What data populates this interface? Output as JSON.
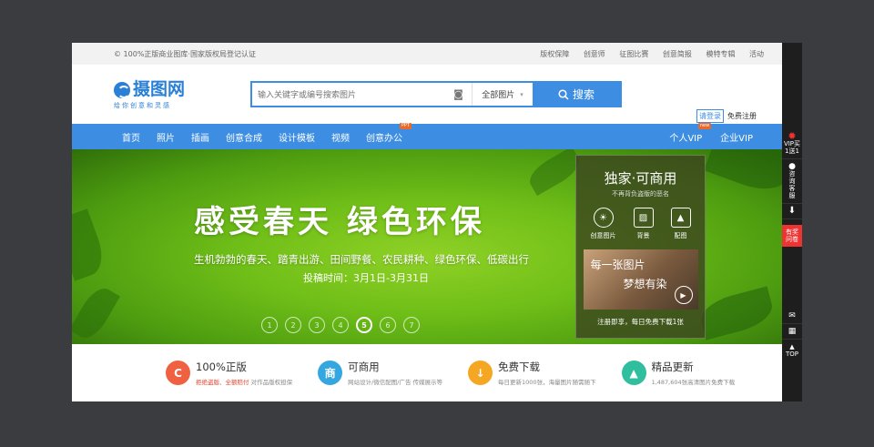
{
  "topbar": {
    "notice": "© 100%正版商业图库·国家版权局登记认证",
    "links": [
      "版权保障",
      "创意师",
      "征图比赛",
      "创意简报",
      "模特专辑",
      "活动"
    ]
  },
  "logo": {
    "name": "摄图网",
    "tagline": "给你创意和灵感"
  },
  "search": {
    "placeholder": "输入关键字或编号搜索图片",
    "category": "全部图片",
    "button": "搜索"
  },
  "auth": {
    "login": "请登录",
    "register": "免费注册"
  },
  "nav": {
    "items": [
      {
        "label": "首页"
      },
      {
        "label": "照片"
      },
      {
        "label": "插画"
      },
      {
        "label": "创意合成"
      },
      {
        "label": "设计模板"
      },
      {
        "label": "视频"
      },
      {
        "label": "创意办公",
        "badge": "PPT"
      }
    ],
    "right": [
      {
        "label": "个人VIP",
        "badge": "new"
      },
      {
        "label": "企业VIP"
      }
    ]
  },
  "banner": {
    "title": "感受春天 绿色环保",
    "subtitle": "生机勃勃的春天、踏青出游、田间野餐、农民耕种、绿色环保、低碳出行",
    "date": "投稿时间：3月1日-3月31日",
    "dots": [
      "1",
      "2",
      "3",
      "4",
      "5",
      "6",
      "7"
    ],
    "active_dot": "5"
  },
  "side_panel": {
    "title": "独家·可商用",
    "subtitle": "不再背负盗版的恶名",
    "features": [
      {
        "icon": "lightbulb-icon",
        "label": "创意图片"
      },
      {
        "icon": "texture-icon",
        "label": "背景"
      },
      {
        "icon": "image-icon",
        "label": "配图"
      }
    ],
    "promo_line1": "每一张图片",
    "promo_line2": "梦想有染",
    "footer": "注册即享，每日免费下载1张"
  },
  "features": [
    {
      "icon": "C",
      "color": "#ef6140",
      "title": "100%正版",
      "desc_red": "拒绝盗版、全额赔付",
      "desc": "对作品版权担保"
    },
    {
      "icon": "商",
      "color": "#35a7e0",
      "title": "可商用",
      "desc_red": "",
      "desc": "网站设计/微信配图/广告 传媒展示等"
    },
    {
      "icon": "↓",
      "color": "#f5a623",
      "title": "免费下载",
      "desc_red": "",
      "desc": "每日更新1000张，海量图片随需随下"
    },
    {
      "icon": "▲",
      "color": "#2fbf9e",
      "title": "精品更新",
      "desc_red": "",
      "desc": "1,487,604张高清图片免费下载"
    }
  ],
  "rail": {
    "vip": "VIP买1送1",
    "service": "咨询客服",
    "prize": "有奖问卷",
    "top": "TOP"
  }
}
